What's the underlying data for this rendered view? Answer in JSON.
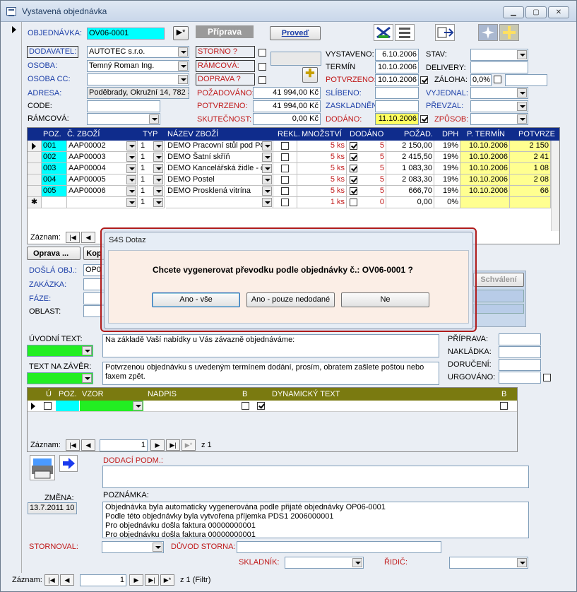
{
  "window": {
    "title": "Vystavená objednávka"
  },
  "header": {
    "objednavka_label": "OBJEDNÁVKA:",
    "objednavka_value": "OV06-0001",
    "status_button": "Příprava",
    "proved_button": "Proveď",
    "dodavatel_label": "DODAVATEL:",
    "dodavatel_value": "AUTOTEC s.r.o.",
    "osoba_label": "OSOBA:",
    "osoba_value": "Temný Roman Ing.",
    "osoba_cc_label": "OSOBA CC:",
    "osoba_cc_value": "",
    "adresa_label": "ADRESA:",
    "adresa_value": "Poděbrady, Okružní 14, 782 3",
    "code_label": "CODE:",
    "ramcova_label": "RÁMCOVÁ:",
    "storno_label": "STORNO ?",
    "ramcova2_label": "RÁMCOVÁ:",
    "doprava_label": "DOPRAVA ?",
    "pozadovano_label": "POŽADOVÁNO:",
    "pozadovano_value": "41 994,00 Kč",
    "potvrzeno_label": "POTVRZENO:",
    "potvrzeno_value": "41 994,00 Kč",
    "skutecnost_label": "SKUTEČNOST:",
    "skutecnost_value": "0,00 Kč",
    "vystaveno_label": "VYSTAVENO:",
    "vystaveno_value": "6.10.2006",
    "termin_label": "TERMÍN",
    "termin_value": "10.10.2006",
    "potvrzeno2_label": "POTVRZENO:",
    "potvrzeno2_value": "10.10.2006",
    "slibeno_label": "SLÍBENO:",
    "zaskladneno_label": "ZASKLADNĚN",
    "dodano_label": "DODÁNO:",
    "dodano_value": "11.10.2006",
    "stav_label": "STAV:",
    "delivery_label": "DELIVERY:",
    "zaloha_label": "ZÁLOHA:",
    "zaloha_value": "0,0%",
    "vyjednal_label": "VYJEDNAL:",
    "prevzal_label": "PŘEVZAL:",
    "zpusob_label": "ZPŮSOB:"
  },
  "items": {
    "columns": [
      "POZ.",
      "Č. ZBOŽÍ",
      "TYP",
      "NÁZEV ZBOŽÍ",
      "REKL.",
      "MNOŽSTVÍ",
      "DODÁNO",
      "POŽAD.",
      "DPH",
      "P. TERMÍN",
      "POTVRZE"
    ],
    "rows": [
      {
        "poz": "001",
        "zbozi": "AAP00002",
        "typ": "1",
        "nazev": "DEMO Pracovní stůl pod PC",
        "mnozstvi": "5 ks",
        "dodano": "5",
        "pozad": "2 150,00",
        "dph": "19%",
        "termin": "10.10.2006",
        "potvr": "2 150"
      },
      {
        "poz": "002",
        "zbozi": "AAP00003",
        "typ": "1",
        "nazev": "DEMO Šatní skříň",
        "mnozstvi": "5 ks",
        "dodano": "5",
        "pozad": "2 415,50",
        "dph": "19%",
        "termin": "10.10.2006",
        "potvr": "2 41"
      },
      {
        "poz": "003",
        "zbozi": "AAP00004",
        "typ": "1",
        "nazev": "DEMO Kancelářská židle - č",
        "mnozstvi": "5 ks",
        "dodano": "5",
        "pozad": "1 083,30",
        "dph": "19%",
        "termin": "10.10.2006",
        "potvr": "1 08"
      },
      {
        "poz": "004",
        "zbozi": "AAP00005",
        "typ": "1",
        "nazev": "DEMO Postel",
        "mnozstvi": "5 ks",
        "dodano": "5",
        "pozad": "2 083,30",
        "dph": "19%",
        "termin": "10.10.2006",
        "potvr": "2 08"
      },
      {
        "poz": "005",
        "zbozi": "AAP00006",
        "typ": "1",
        "nazev": "DEMO Prosklená vitrína",
        "mnozstvi": "5 ks",
        "dodano": "5",
        "pozad": "666,70",
        "dph": "19%",
        "termin": "10.10.2006",
        "potvr": "66"
      }
    ],
    "new_row": {
      "typ": "1",
      "mnozstvi": "1 ks",
      "dodano": "0",
      "pozad": "0,00",
      "dph": "0%"
    },
    "nav_label": "Záznam:"
  },
  "mid": {
    "oprava_button": "Oprava ...",
    "kop_button": "Kop",
    "dosla_label": "DOŠLÁ OBJ.:",
    "dosla_value": "OP0",
    "zakazka_label": "ZAKÁZKA:",
    "faze_label": "FÁZE:",
    "oblast_label": "OBLAST:",
    "schvaleni_button": "Schválení",
    "uvodni_label": "ÚVODNÍ TEXT:",
    "uvodni_text": "Na základě Vaší nabídky u Vás závazně objednáváme:",
    "zaver_label": "TEXT NA ZÁVĚR:",
    "zaver_text": "Potvrzenou objednávku s uvedeným termínem dodání, prosím, obratem zašlete poštou nebo faxem zpět.",
    "priprava_label": "PŘÍPRAVA:",
    "nakladka_label": "NAKLÁDKA:",
    "doruceni_label": "DORUČENÍ:",
    "urgovano_label": "URGOVÁNO:"
  },
  "texts_grid": {
    "columns": [
      "Ú",
      "POZ.",
      "VZOR",
      "NADPIS",
      "B",
      "DYNAMICKÝ TEXT",
      "B"
    ],
    "nav_label": "Záznam:",
    "nav_pos": "1",
    "nav_total": "z 1"
  },
  "bottom": {
    "dodaci_label": "DODACÍ PODM.:",
    "zmena_label": "ZMĚNA:",
    "zmena_value": "13.7.2011 10",
    "poznamka_label": "POZNÁMKA:",
    "poznamka_lines": [
      "Objednávka byla automaticky vygenerována podle přijaté objednávky OP06-0001",
      "Podle této objednávky byla vytvořena příjemka PDS1  2006000001",
      "Pro objednávku došla faktura 00000000001",
      "Pro objednávku došla faktura 00000000001"
    ],
    "stornoval_label": "STORNOVAL:",
    "duvod_label": "DŮVOD STORNA:",
    "skladnik_label": "SKLADNÍK:",
    "ridic_label": "ŘIDIČ:"
  },
  "statusbar": {
    "nav_label": "Záznam:",
    "nav_pos": "1",
    "nav_total": "z 1 (Filtr)"
  },
  "dialog": {
    "title": "S4S Dotaz",
    "message": "Chcete vygenerovat převodku podle objednávky č.: OV06-0001 ?",
    "btn_all": "Ano - vše",
    "btn_partial": "Ano - pouze nedodané",
    "btn_no": "Ne"
  }
}
